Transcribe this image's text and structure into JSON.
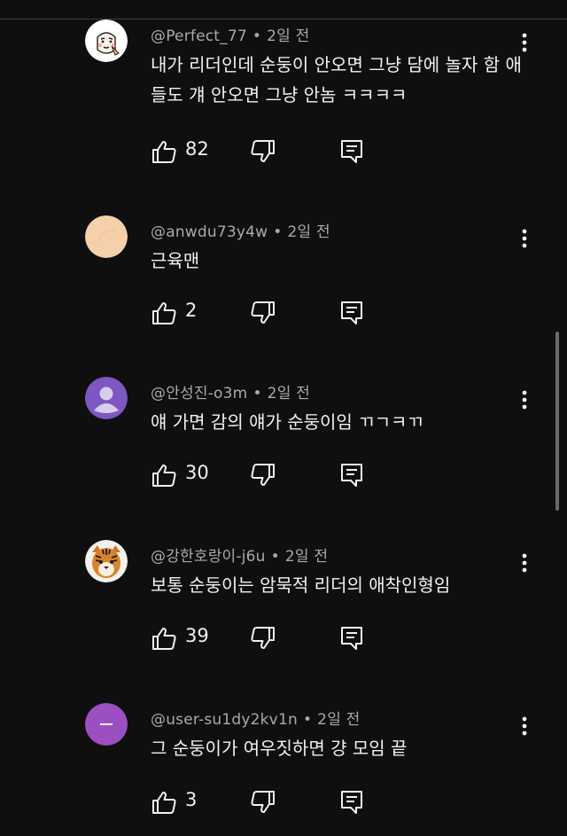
{
  "comments": [
    {
      "author": "@Perfect_77",
      "time": "2일 전",
      "text": "내가 리더인데 순둥이 안오면 그냥 담에 놀자 함 애들도 걔 안오면 그냥 안놈 ㅋㅋㅋㅋ",
      "likes": "82",
      "avatar": "cartoon-face"
    },
    {
      "author": "@anwdu73y4w",
      "time": "2일 전",
      "text": "근육맨",
      "likes": "2",
      "avatar": "peach-circle"
    },
    {
      "author": "@안성진-o3m",
      "time": "2일 전",
      "text": "얘 가면 감의 얘가 순둥이임 ㄲㄱㅋㄲ",
      "likes": "30",
      "avatar": "default-person"
    },
    {
      "author": "@강한호랑이-j6u",
      "time": "2일 전",
      "text": "보통 순둥이는 암묵적 리더의 애착인형임",
      "likes": "39",
      "avatar": "tiger"
    },
    {
      "author": "@user-su1dy2kv1n",
      "time": "2일 전",
      "text": "그 순둥이가 여우짓하면 걍 모임 끝",
      "likes": "3",
      "avatar": "purple-dash"
    }
  ],
  "colors": {
    "background": "#0f0f0f",
    "text_primary": "#f1f1f1",
    "text_secondary": "#aaaaaa",
    "avatar_peach": "#f6cfab",
    "avatar_purple": "#7e57c2",
    "avatar_magenta": "#9c4fc1"
  }
}
